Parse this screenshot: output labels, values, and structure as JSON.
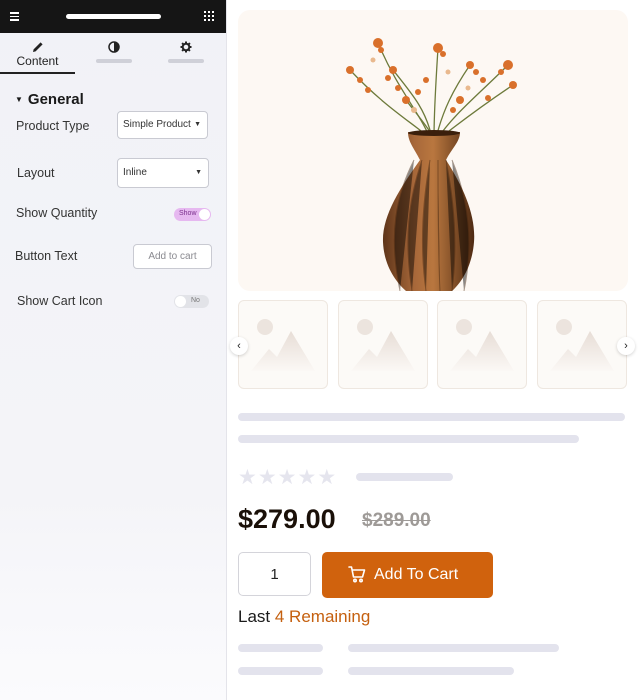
{
  "editor": {
    "tabs": [
      {
        "label": "Content",
        "icon": "pencil-icon",
        "active": true
      },
      {
        "label": "",
        "icon": "style-contrast-icon",
        "active": false
      },
      {
        "label": "",
        "icon": "gear-icon",
        "active": false
      }
    ],
    "section_title": "General",
    "fields": {
      "product_type": {
        "label": "Product Type",
        "value": "Simple Product"
      },
      "layout": {
        "label": "Layout",
        "value": "Inline"
      },
      "show_quantity": {
        "label": "Show Quantity",
        "state": "Show",
        "on": true
      },
      "button_text": {
        "label": "Button Text",
        "placeholder": "Add to cart"
      },
      "show_cart_icon": {
        "label": "Show Cart Icon",
        "state": "No",
        "on": false
      }
    }
  },
  "preview": {
    "rating": 0,
    "max_rating": 5,
    "price": "$279.00",
    "old_price": "$289.00",
    "quantity": "1",
    "cart_button_label": "Add To Cart",
    "stock_prefix": "Last",
    "stock_count": "4 Remaining",
    "colors": {
      "accent": "#d0620d",
      "stock_highlight": "#c5600f",
      "hero_bg": "#fdf8f3",
      "toggle_on": "#e6b8f0"
    }
  }
}
